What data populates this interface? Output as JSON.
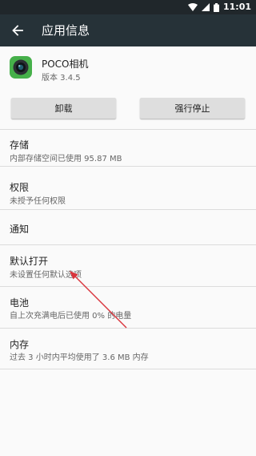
{
  "status_bar": {
    "time": "11:01"
  },
  "appbar": {
    "title": "应用信息"
  },
  "app": {
    "name": "POCO相机",
    "version": "版本 3.4.5"
  },
  "buttons": {
    "uninstall": "卸载",
    "force_stop": "强行停止"
  },
  "items": [
    {
      "title": "存储",
      "summary": "内部存储空间已使用 95.87 MB"
    },
    {
      "title": "权限",
      "summary": "未授予任何权限"
    },
    {
      "title": "通知",
      "summary": ""
    },
    {
      "title": "默认打开",
      "summary": "未设置任何默认选项"
    },
    {
      "title": "电池",
      "summary": "自上次充满电后已使用 0% 的电量"
    },
    {
      "title": "内存",
      "summary": "过去 3 小时内平均使用了 3.6 MB 内存"
    }
  ],
  "colors": {
    "status_bar": "#20272b",
    "app_bar": "#263238",
    "annotation_arrow": "#d9343c",
    "app_icon": "#46b04a"
  }
}
